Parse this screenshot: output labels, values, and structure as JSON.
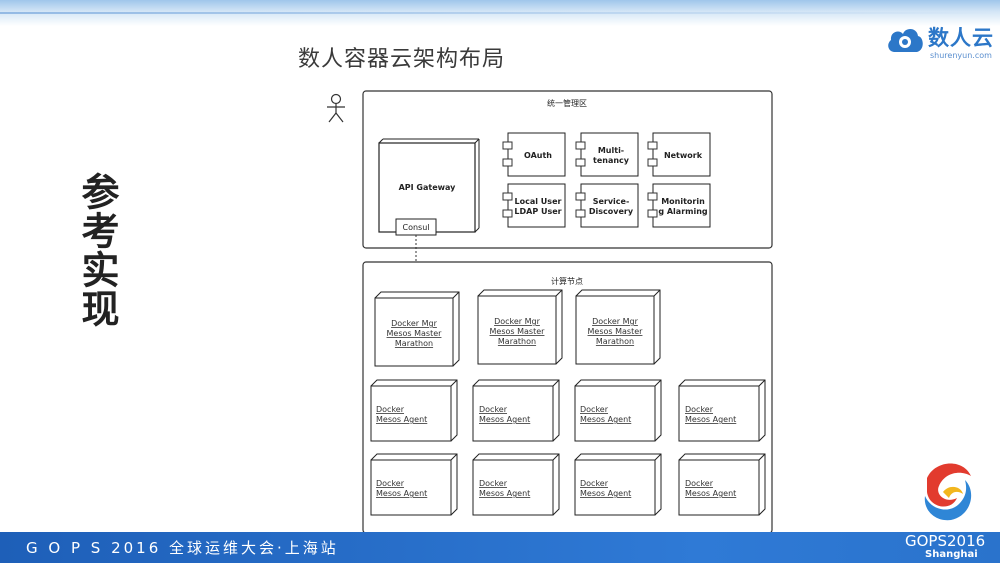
{
  "header": {
    "logo_text": "数人云",
    "logo_sub": "shurenyun.com"
  },
  "slide": {
    "title": "数人容器云架构布局",
    "side_heading": "参考实现"
  },
  "diagram": {
    "mgmt_zone": {
      "title": "统一管理区",
      "gateway": {
        "label": "API  Gateway",
        "consul": "Consul"
      },
      "components": [
        {
          "line1": "OAuth",
          "line2": ""
        },
        {
          "line1": "Multi-",
          "line2": "tenancy"
        },
        {
          "line1": "Network",
          "line2": ""
        },
        {
          "line1": "Local User",
          "line2": "LDAP User"
        },
        {
          "line1": "Service-",
          "line2": "Discovery"
        },
        {
          "line1": "Monitorin",
          "line2": "g Alarming"
        }
      ]
    },
    "compute_zone": {
      "title": "计算节点",
      "masters": [
        {
          "line1": "Docker Mgr",
          "line2": "Mesos Master",
          "line3": "Marathon"
        },
        {
          "line1": "Docker Mgr",
          "line2": "Mesos Master",
          "line3": "Marathon"
        },
        {
          "line1": "Docker Mgr",
          "line2": "Mesos Master",
          "line3": "Marathon"
        }
      ],
      "agents": [
        {
          "line1": "Docker",
          "line2": "Mesos Agent"
        },
        {
          "line1": "Docker",
          "line2": "Mesos Agent"
        },
        {
          "line1": "Docker",
          "line2": "Mesos Agent"
        },
        {
          "line1": "Docker",
          "line2": "Mesos Agent"
        },
        {
          "line1": "Docker",
          "line2": "Mesos Agent"
        },
        {
          "line1": "Docker",
          "line2": "Mesos Agent"
        },
        {
          "line1": "Docker",
          "line2": "Mesos Agent"
        },
        {
          "line1": "Docker",
          "line2": "Mesos Agent"
        }
      ]
    }
  },
  "footer": {
    "text": "G O P S 2016 全球运维大会·上海站",
    "brand": "GOPS2016",
    "brand_sub": "Shanghai"
  },
  "colors": {
    "footer_bg": "#2a73cc",
    "logo_blue": "#2c77c8"
  }
}
